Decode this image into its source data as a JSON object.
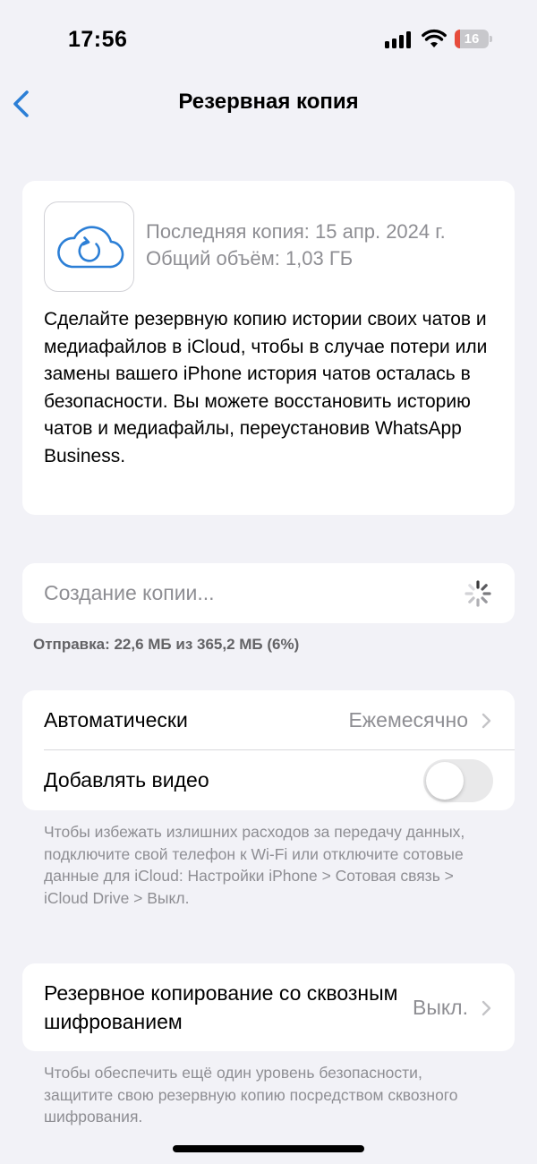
{
  "status_bar": {
    "time": "17:56",
    "battery_level": "16",
    "battery_fraction": 0.16,
    "battery_color": "#e74c3c",
    "icons": [
      "signal-icon",
      "wifi-icon",
      "battery-icon"
    ]
  },
  "nav": {
    "back_icon": "chevron-left-icon",
    "title": "Резервная копия"
  },
  "backup_info": {
    "icon": "icloud-backup-icon",
    "last_backup": "Последняя копия: 15 апр. 2024 г.",
    "total_size": "Общий объём: 1,03 ГБ",
    "description": "Сделайте резервную копию истории своих чатов и медиафайлов в iCloud, чтобы в случае потери или замены вашего iPhone история чатов осталась в безопасности. Вы можете восстановить историю чатов и медиафайлы, переустановив WhatsApp Business."
  },
  "progress": {
    "label": "Создание копии...",
    "status": "Отправка: 22,6 МБ из 365,2 МБ (6%)"
  },
  "settings": {
    "auto_label": "Автоматически",
    "auto_value": "Ежемесячно",
    "video_label": "Добавлять видео",
    "video_enabled": false,
    "note": "Чтобы избежать излишних расходов за передачу данных, подключите свой телефон к Wi-Fi или отключите сотовые данные для iCloud: Настройки iPhone > Сотовая связь > iCloud Drive > Выкл."
  },
  "encryption": {
    "label": "Резервное копирование со сквозным шифрованием",
    "value": "Выкл.",
    "note": "Чтобы обеспечить ещё один уровень безопасности, защитите свою резервную копию посредством сквозного шифрования."
  },
  "colors": {
    "accent": "#2c7fd6",
    "background": "#f2f2f7",
    "secondary_text": "#8e8e93"
  }
}
